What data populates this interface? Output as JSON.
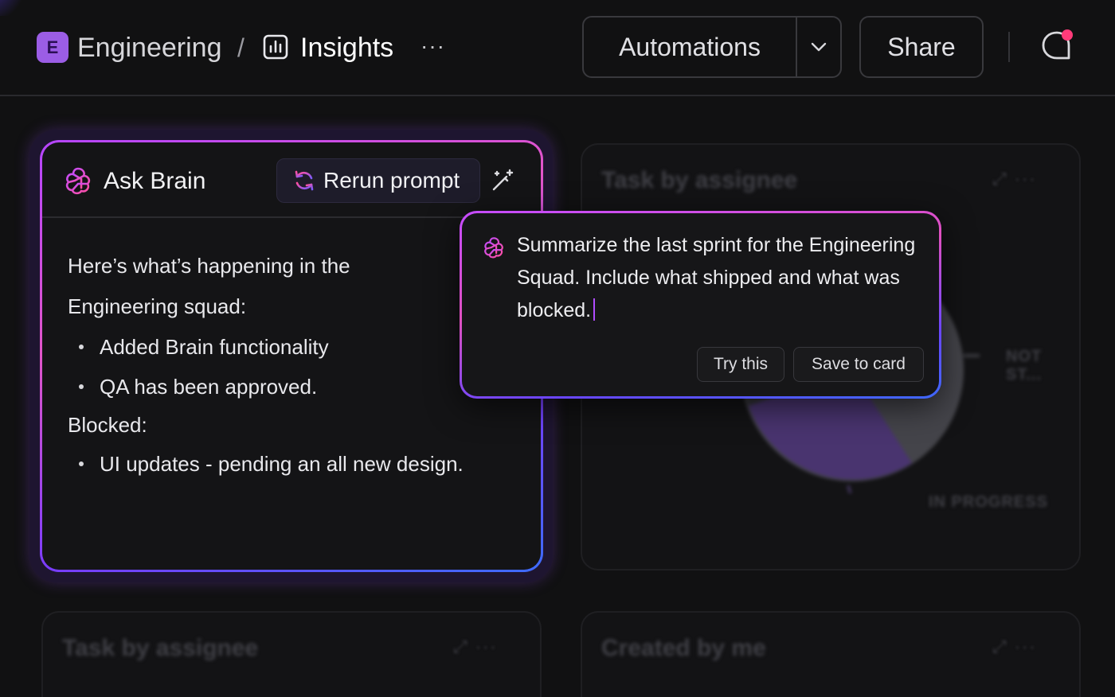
{
  "header": {
    "workspace_initial": "E",
    "workspace_name": "Engineering",
    "separator": "/",
    "page_title": "Insights",
    "more_label": "···",
    "automations_label": "Automations",
    "share_label": "Share"
  },
  "ask_brain": {
    "title": "Ask Brain",
    "rerun_label": "Rerun prompt",
    "intro": "Here’s what’s happening in the Engineering squad:",
    "shipped_items": [
      "Added Brain functionality",
      "QA has been approved."
    ],
    "blocked_label": "Blocked:",
    "blocked_items": [
      "UI updates - pending an all new design."
    ]
  },
  "prompt_popup": {
    "text": "Summarize the last sprint for the Engineering Squad. Include what shipped and what was blocked.",
    "try_label": "Try this",
    "save_label": "Save to card"
  },
  "background_cards": {
    "top_right_title": "Task by assignee",
    "pie_label_not_started": "NOT ST...",
    "pie_label_in_progress": "IN PROGRESS",
    "bottom_left_title": "Task by assignee",
    "bottom_right_title": "Created by me"
  },
  "colors": {
    "background": "#111112",
    "accent_purple": "#9b5de5",
    "notification_dot": "#ff3b7a",
    "gradient_pink": "#e255c9",
    "gradient_blue": "#3d6cff"
  },
  "icons": {
    "workspace": "workspace-badge-icon",
    "insights": "dashboard-chart-icon",
    "caret": "chevron-down-icon",
    "chat": "chat-bubble-icon",
    "brain": "brain-logo-icon",
    "rerun": "refresh-icon",
    "edit_prompt": "magic-wand-icon"
  }
}
